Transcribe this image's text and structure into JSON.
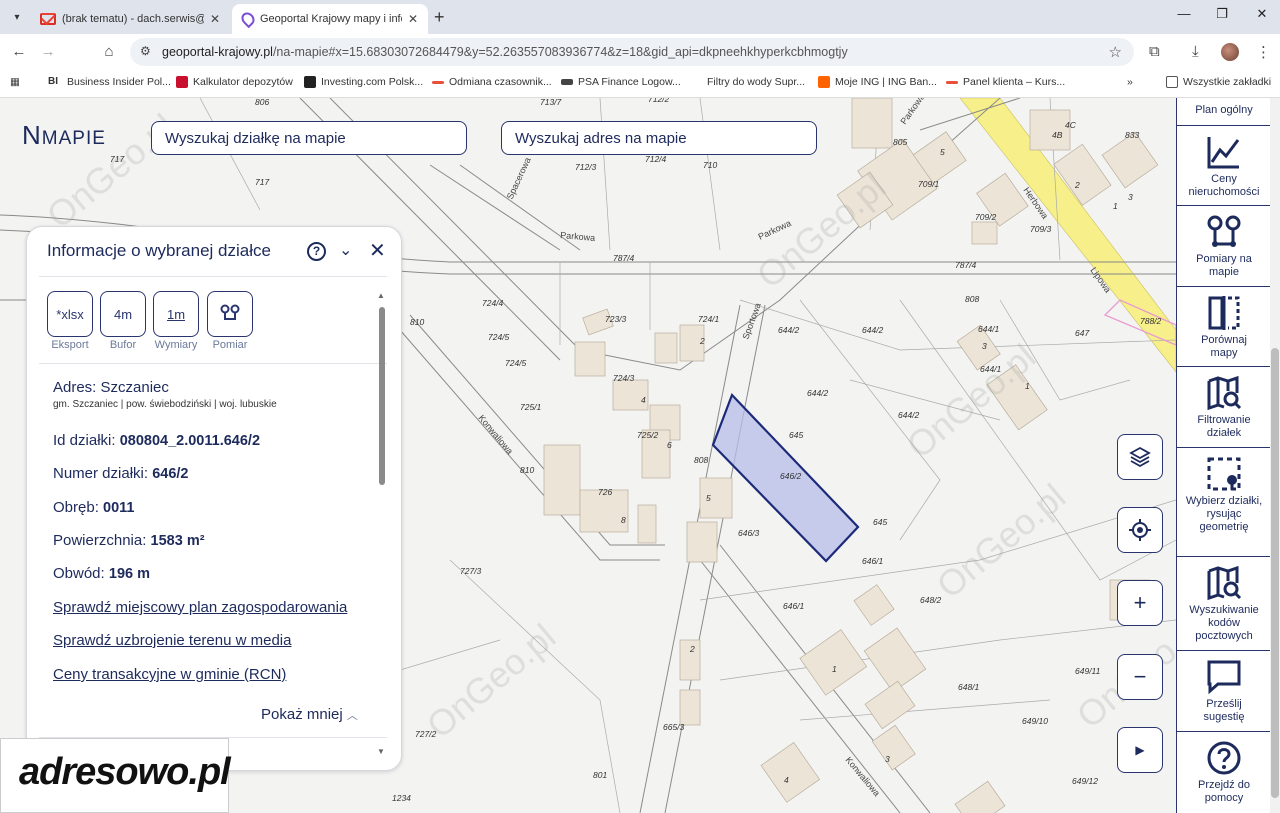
{
  "browser": {
    "tabs": [
      {
        "title": "(brak tematu) - dach.serwis@gm"
      },
      {
        "title": "Geoportal Krajowy mapy i infor"
      }
    ],
    "url_host": "geoportal-krajowy.pl",
    "url_path": "/na-mapie#x=15.68303072684479&y=52.263557083936774&z=18&gid_api=dkpneehkhyperkcbhmogtjy",
    "bookmarks": [
      {
        "label": "Business Insider Pol...",
        "color": "#111111"
      },
      {
        "label": "Kalkulator depozytów",
        "color": "#c8102e"
      },
      {
        "label": "Investing.com Polsk...",
        "color": "#222222"
      },
      {
        "label": "Odmiana czasownik...",
        "color": "#e8503a"
      },
      {
        "label": "PSA Finance Logow...",
        "color": "#444444"
      },
      {
        "label": "Filtry do wody Supr...",
        "color": "#ffffff"
      },
      {
        "label": "Moje ING | ING Ban...",
        "color": "#ff6200"
      },
      {
        "label": "Panel klienta – Kurs...",
        "color": "#e8503a"
      }
    ],
    "all_bookmarks": "Wszystkie zakładki"
  },
  "map": {
    "logo": "MAPIE",
    "logo_prefix": "N",
    "search_plot": "Wyszukaj działkę na mapie",
    "search_address": "Wyszukaj adres na mapie",
    "watermark": "OnGeo.pl",
    "streets": {
      "parkowa1": "Parkowa",
      "parkowa2": "Parkowa",
      "parkowa3": "Parkowa",
      "spacerowa": "Spacerowa",
      "sportowa": "Sportowa",
      "konwaliowa1": "Konwaliowa",
      "konwaliowa2": "Konwaliowa",
      "herbowa": "Herbowa",
      "lipowa": "Lipowa"
    },
    "plots": [
      "806",
      "713/7",
      "712/2",
      "712/3",
      "712/4",
      "710",
      "717",
      "717",
      "805",
      "709/1",
      "709/2",
      "709/3",
      "4B",
      "4C",
      "833",
      "2",
      "1",
      "3",
      "5",
      "787/4",
      "787/4",
      "808",
      "724/4",
      "724/5",
      "724/5",
      "723/3",
      "724/1",
      "2",
      "810",
      "724/3",
      "4",
      "725/1",
      "725/2",
      "6",
      "644/2",
      "644/2",
      "644/2",
      "644/2",
      "644/1",
      "644/1",
      "3",
      "1",
      "647",
      "788/2",
      "645",
      "646/2",
      "808",
      "5",
      "726",
      "8",
      "810",
      "646/3",
      "645",
      "646/1",
      "727/3",
      "646/1",
      "648/2",
      "2",
      "1",
      "649/11",
      "648/1",
      "649/10",
      "665/3",
      "727/2",
      "3",
      "4",
      "801",
      "649/12",
      "1234"
    ]
  },
  "panel": {
    "title": "Informacje o wybranej działce",
    "tools": [
      {
        "icon": "*xlsx",
        "label": "Eksport"
      },
      {
        "icon": "4m",
        "label": "Bufor"
      },
      {
        "icon": "1m",
        "label": "Wymiary"
      },
      {
        "icon": "pomiar",
        "label": "Pomiar"
      }
    ],
    "address_title": "Adres: Szczaniec",
    "address_sub": "gm. Szczaniec | pow. świebodziński | woj. lubuskie",
    "rows": [
      {
        "label": "Id działki: ",
        "value": "080804_2.0011.646/2"
      },
      {
        "label": "Numer działki: ",
        "value": "646/2"
      },
      {
        "label": "Obręb: ",
        "value": "0011"
      },
      {
        "label": "Powierzchnia: ",
        "value": "1583 m²"
      },
      {
        "label": "Obwód: ",
        "value": "196 m"
      }
    ],
    "links": [
      "Sprawdź miejscowy plan zagospodarowania",
      "Sprawdź uzbrojenie terenu w media",
      "Ceny transakcyjne w gminie (RCN)"
    ],
    "show_less": "Pokaż mniej"
  },
  "adresowo": "adresowo.pl",
  "sidebar": [
    {
      "label": "Plan ogólny",
      "icon": "plan-icon"
    },
    {
      "label": "Ceny nieruchomości",
      "icon": "price-chart-icon"
    },
    {
      "label": "Pomiary na mapie",
      "icon": "measure-icon"
    },
    {
      "label": "Porównaj mapy",
      "icon": "compare-icon"
    },
    {
      "label": "Filtrowanie działek",
      "icon": "filter-map-icon"
    },
    {
      "label": "Wybierz działki, rysując geometrię",
      "icon": "select-geometry-icon"
    },
    {
      "label": "Wyszukiwanie kodów pocztowych",
      "icon": "postal-search-icon"
    },
    {
      "label": "Prześlij sugestię",
      "icon": "chat-icon"
    },
    {
      "label": "Przejdź do pomocy",
      "icon": "help-icon"
    }
  ],
  "colors": {
    "navy": "#1d2a5c",
    "parcel_fill": "#b8bde8",
    "parcel_stroke": "#1c2a7a",
    "road_yellow": "#f7ef8a"
  }
}
